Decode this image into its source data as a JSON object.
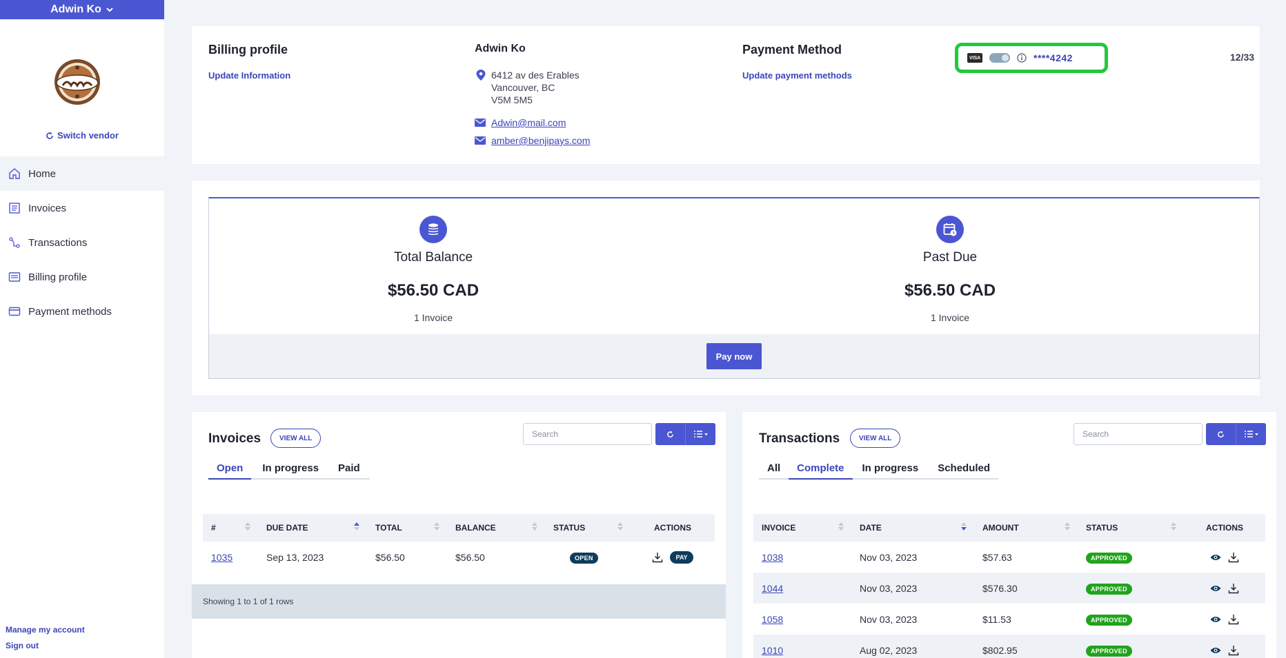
{
  "user": {
    "name": "Adwin Ko"
  },
  "sidebar": {
    "switch_vendor": "Switch vendor",
    "nav": [
      {
        "label": "Home"
      },
      {
        "label": "Invoices"
      },
      {
        "label": "Transactions"
      },
      {
        "label": "Billing profile"
      },
      {
        "label": "Payment methods"
      }
    ],
    "manage_account": "Manage my account",
    "sign_out": "Sign out"
  },
  "billing": {
    "title": "Billing profile",
    "update_info": "Update Information",
    "name": "Adwin Ko",
    "address": [
      "6412 av des Erables",
      "Vancouver, BC",
      "V5M 5M5"
    ],
    "emails": [
      "Adwin@mail.com",
      "amber@benjipays.com"
    ],
    "payment_title": "Payment Method",
    "update_payment": "Update payment methods",
    "card_brand": "VISA",
    "card_number": "****4242",
    "expiry": "12/33"
  },
  "balance": {
    "total_label": "Total Balance",
    "total_amount": "$56.50 CAD",
    "total_count": "1 Invoice",
    "past_label": "Past Due",
    "past_amount": "$56.50 CAD",
    "past_count": "1 Invoice",
    "pay_now": "Pay now"
  },
  "invoices": {
    "title": "Invoices",
    "view_all": "VIEW ALL",
    "search_placeholder": "Search",
    "tabs": [
      "Open",
      "In progress",
      "Paid"
    ],
    "columns": [
      "#",
      "DUE DATE",
      "TOTAL",
      "BALANCE",
      "STATUS",
      "ACTIONS"
    ],
    "rows": [
      {
        "num": "1035",
        "due": "Sep 13, 2023",
        "total": "$56.50",
        "balance": "$56.50",
        "status": "OPEN",
        "pay": "PAY"
      }
    ],
    "footer": "Showing 1 to 1 of 1 rows"
  },
  "transactions": {
    "title": "Transactions",
    "view_all": "VIEW ALL",
    "search_placeholder": "Search",
    "tabs": [
      "All",
      "Complete",
      "In progress",
      "Scheduled"
    ],
    "columns": [
      "INVOICE",
      "DATE",
      "AMOUNT",
      "STATUS",
      "ACTIONS"
    ],
    "rows": [
      {
        "invoice": "1038",
        "date": "Nov 03, 2023",
        "amount": "$57.63",
        "status": "APPROVED"
      },
      {
        "invoice": "1044",
        "date": "Nov 03, 2023",
        "amount": "$576.30",
        "status": "APPROVED"
      },
      {
        "invoice": "1058",
        "date": "Nov 03, 2023",
        "amount": "$11.53",
        "status": "APPROVED"
      },
      {
        "invoice": "1010",
        "date": "Aug 02, 2023",
        "amount": "$802.95",
        "status": "APPROVED"
      }
    ]
  },
  "colors": {
    "accent": "#4b56d2",
    "highlight": "#23c93c",
    "approved": "#21a31c",
    "open": "#0d3d5c"
  }
}
